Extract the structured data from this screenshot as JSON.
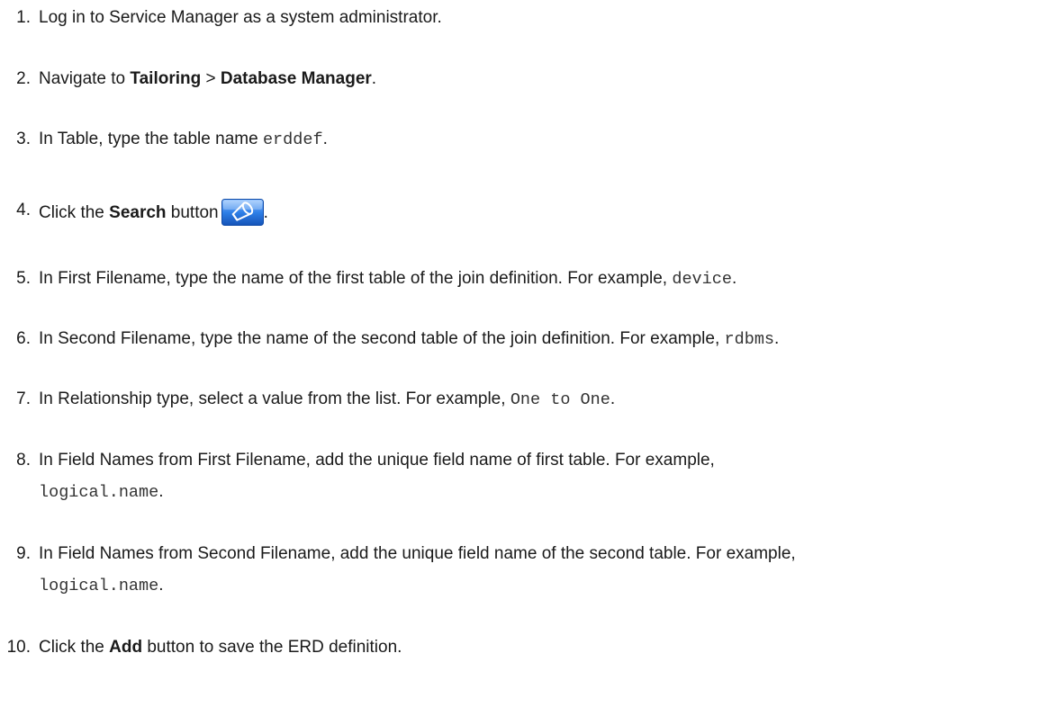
{
  "steps": [
    {
      "num": "1.",
      "a": "Log in to Service Manager as a system administrator."
    },
    {
      "num": "2.",
      "a": "Navigate to ",
      "b1": "Tailoring",
      "c": " > ",
      "b2": "Database Manager",
      "d": "."
    },
    {
      "num": "3.",
      "a": "In Table, type the table name ",
      "code": "erddef",
      "d": "."
    },
    {
      "num": "4.",
      "a": "Click the ",
      "b1": "Search",
      "c": " button",
      "d": ".",
      "icon": "search-flashlight-icon"
    },
    {
      "num": "5.",
      "a": "In First Filename, type the name of the first table of the join definition. For example, ",
      "code": "device",
      "d": "."
    },
    {
      "num": "6.",
      "a": "In Second Filename, type the name of the second table of the join definition. For example, ",
      "code": "rdbms",
      "d": "."
    },
    {
      "num": "7.",
      "a": "In Relationship type, select a value from the list. For example, ",
      "code": "One to One",
      "d": "."
    },
    {
      "num": "8.",
      "a": "In Field Names from First Filename, add the unique field name of first table. For example,",
      "code": "logical.name",
      "d": "."
    },
    {
      "num": "9.",
      "a": "In Field Names from Second Filename, add the unique field name of the second table. For example,",
      "code": "logical.name",
      "d": "."
    },
    {
      "num": "10.",
      "a": "Click the ",
      "b1": "Add",
      "c": " button to save the ERD definition."
    }
  ],
  "colors": {
    "text": "#1a1a1a",
    "icon_blue": "#1f6fd6",
    "icon_light": "#7fb6ff"
  }
}
